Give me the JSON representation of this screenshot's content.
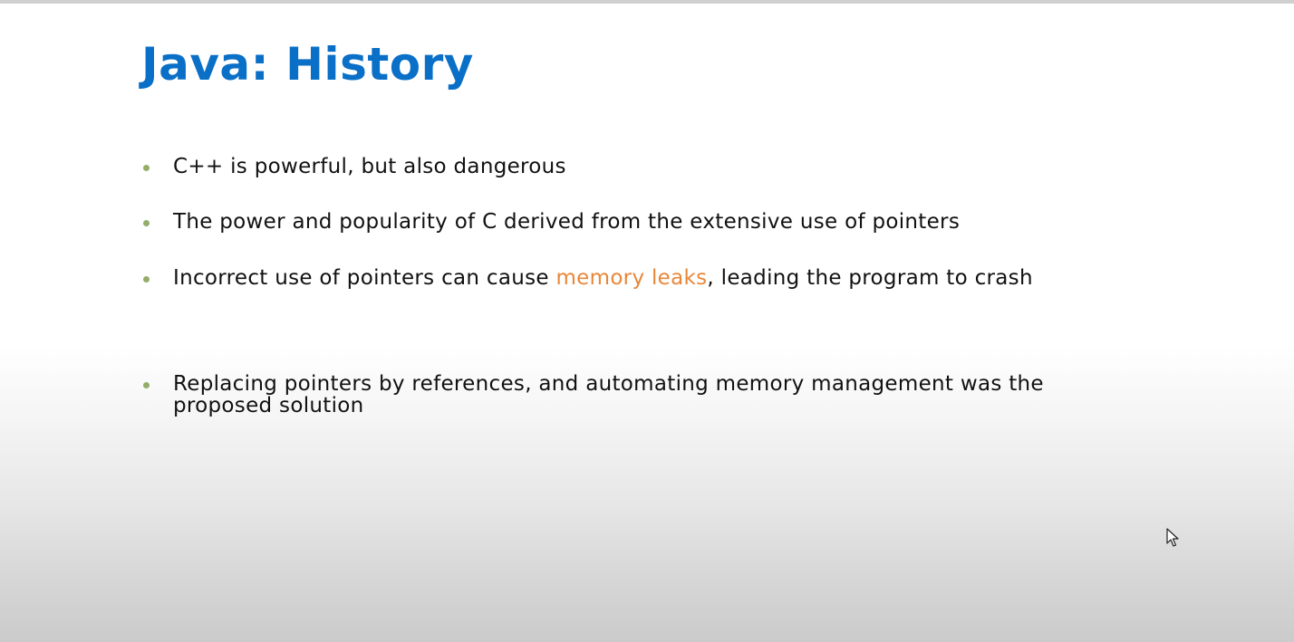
{
  "slide": {
    "title": "Java: History",
    "bullets": [
      {
        "text": "C++ is powerful, but also dangerous"
      },
      {
        "text": "The power and popularity of C derived from the extensive use of pointers"
      },
      {
        "before": "Incorrect use of pointers can cause ",
        "highlight": "memory leaks",
        "after": ", leading the program to crash"
      },
      {
        "text": "Replacing pointers by references, and automating memory management was the proposed solution"
      }
    ]
  },
  "colors": {
    "title": "#0a6fc7",
    "bullet_marker": "#93ad6a",
    "highlight": "#e8873a",
    "body_text": "#111111"
  },
  "icons": {
    "cursor": "mouse-pointer-icon"
  }
}
